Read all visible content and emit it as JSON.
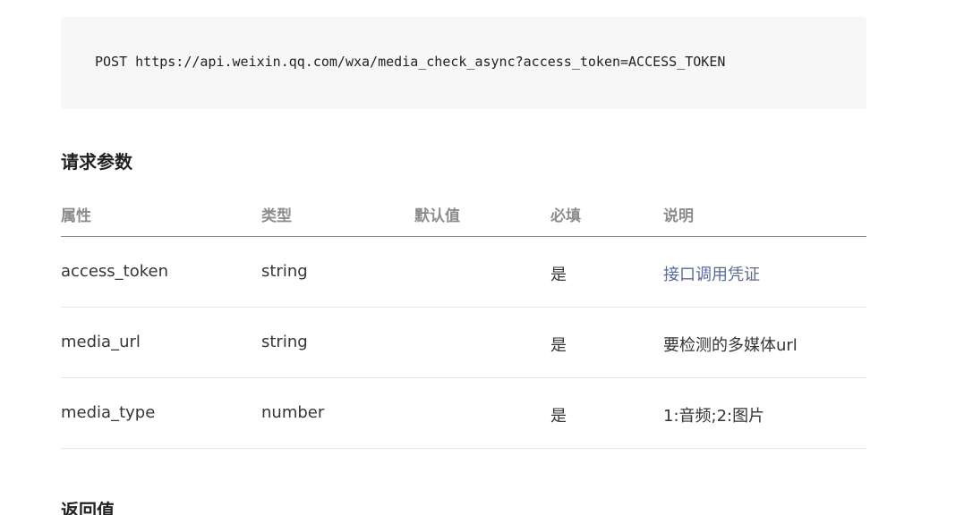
{
  "request": {
    "code": "POST https://api.weixin.qq.com/wxa/media_check_async?access_token=ACCESS_TOKEN"
  },
  "params_section": {
    "title": "请求参数",
    "headers": [
      "属性",
      "类型",
      "默认值",
      "必填",
      "说明"
    ],
    "rows": [
      {
        "name": "access_token",
        "type": "string",
        "default": "",
        "required": "是",
        "desc": "接口调用凭证",
        "desc_is_link": true
      },
      {
        "name": "media_url",
        "type": "string",
        "default": "",
        "required": "是",
        "desc": "要检测的多媒体url",
        "desc_is_link": false
      },
      {
        "name": "media_type",
        "type": "number",
        "default": "",
        "required": "是",
        "desc": "1:音频;2:图片",
        "desc_is_link": false
      }
    ]
  },
  "return_section": {
    "title": "返回值"
  },
  "colors": {
    "link": "#576b95",
    "header_text": "#8c8c8c",
    "code_bg": "#f7f7f7"
  }
}
